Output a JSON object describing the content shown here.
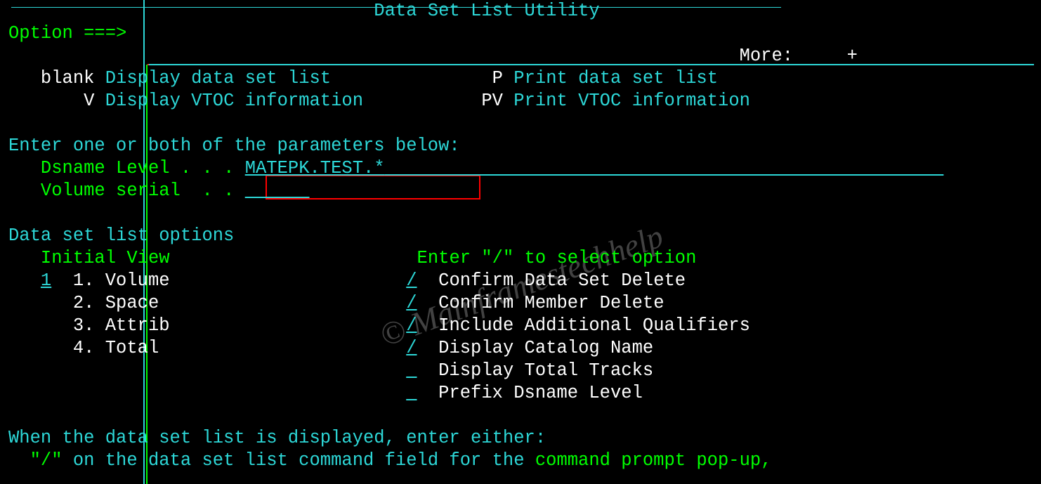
{
  "panel_title": "Data Set List Utility",
  "option_label": "Option ===>",
  "option_value": "",
  "more_label": "More:",
  "more_indicator": "+",
  "menu": {
    "blank_key": "blank",
    "blank_desc": "Display data set list",
    "p_key": "P",
    "p_desc": "Print data set list",
    "v_key": "V",
    "v_desc": "Display VTOC information",
    "pv_key": "PV",
    "pv_desc": "Print VTOC information"
  },
  "params_heading": "Enter one or both of the parameters below:",
  "dsname_label": "Dsname Level . . .",
  "dsname_value": "MATEPK.TEST.*",
  "volser_label": "Volume serial  . .",
  "volser_value": "",
  "options_heading": "Data set list options",
  "initial_view_label": "Initial View",
  "initial_view_value": "1",
  "views": {
    "v1": "1. Volume",
    "v2": "2. Space",
    "v3": "3. Attrib",
    "v4": "4. Total"
  },
  "select_heading": "Enter \"/\" to select option",
  "opts": {
    "confirm_ds_val": "/",
    "confirm_ds_lbl": "Confirm Data Set Delete",
    "confirm_mb_val": "/",
    "confirm_mb_lbl": "Confirm Member Delete",
    "incl_q_val": "/",
    "incl_q_lbl": "Include Additional Qualifiers",
    "catalog_val": "/",
    "catalog_lbl": "Display Catalog Name",
    "tracks_val": " ",
    "tracks_lbl": "Display Total Tracks",
    "prefix_val": " ",
    "prefix_lbl": "Prefix Dsname Level"
  },
  "footer_a": "When the data set list is displayed, enter either:",
  "footer_quote": "\"/\"",
  "footer_on": " on the data set list command field for the ",
  "footer_cmd": "command prompt pop-up,",
  "watermark": "© Mainframestechhelp"
}
